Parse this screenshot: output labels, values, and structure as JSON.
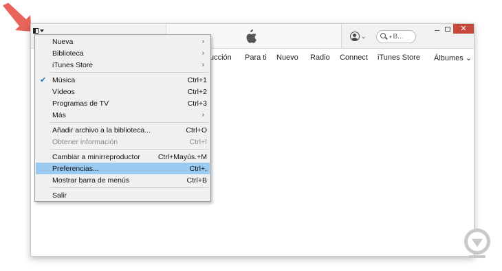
{
  "colors": {
    "arrow": "#e8635a",
    "highlight": "#9ac9f2",
    "close_button": "#c7483a",
    "check": "#1a6fc2"
  },
  "titlebar": {
    "menu_toggle_icon": "sidebar-toggle-icon",
    "search": {
      "value": "B...",
      "icon": "search-icon"
    },
    "account_icon": "account-icon"
  },
  "navbar": {
    "tabs": [
      {
        "label": "ucción"
      },
      {
        "label": "Para ti"
      },
      {
        "label": "Nuevo"
      },
      {
        "label": "Radio"
      },
      {
        "label": "Connect"
      },
      {
        "label": "iTunes Store"
      },
      {
        "label": "Álbumes ⌄"
      }
    ]
  },
  "menu": {
    "items": [
      {
        "label": "Nueva",
        "shortcut": "",
        "submenu": true
      },
      {
        "label": "Biblioteca",
        "shortcut": "",
        "submenu": true
      },
      {
        "label": "iTunes Store",
        "shortcut": "",
        "submenu": true
      },
      {
        "label": "Música",
        "shortcut": "Ctrl+1",
        "checked": true
      },
      {
        "label": "Vídeos",
        "shortcut": "Ctrl+2"
      },
      {
        "label": "Programas de TV",
        "shortcut": "Ctrl+3"
      },
      {
        "label": "Más",
        "shortcut": "",
        "submenu": true
      },
      {
        "label": "Añadir archivo a la biblioteca...",
        "shortcut": "Ctrl+O"
      },
      {
        "label": "Obtener información",
        "shortcut": "Ctrl+I",
        "disabled": true
      },
      {
        "label": "Cambiar a minirreproductor",
        "shortcut": "Ctrl+Mayús.+M"
      },
      {
        "label": "Preferencias...",
        "shortcut": "Ctrl+,",
        "highlighted": true
      },
      {
        "label": "Mostrar barra de menús",
        "shortcut": "Ctrl+B"
      },
      {
        "label": "Salir",
        "shortcut": ""
      }
    ],
    "submenu_arrow": "›",
    "check_mark": "✔"
  },
  "window_controls": {
    "close_label": "✕"
  }
}
